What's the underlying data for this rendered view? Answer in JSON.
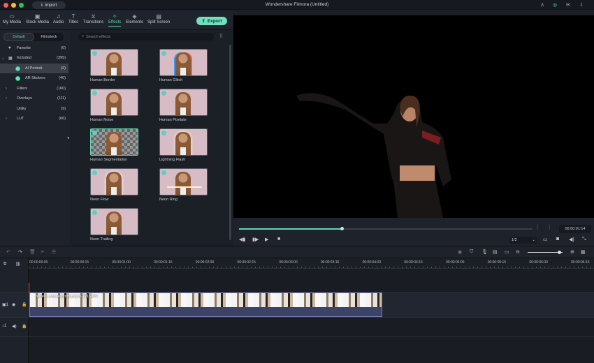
{
  "window": {
    "title": "Wondershare Filmora (Untitled)",
    "import_label": "Import"
  },
  "toolbar": {
    "tabs": [
      {
        "label": "My Media",
        "icon": "folder-icon"
      },
      {
        "label": "Stock Media",
        "icon": "image-icon"
      },
      {
        "label": "Audio",
        "icon": "music-icon"
      },
      {
        "label": "Titles",
        "icon": "text-icon"
      },
      {
        "label": "Transitions",
        "icon": "transition-icon"
      },
      {
        "label": "Effects",
        "icon": "effects-icon"
      },
      {
        "label": "Elements",
        "icon": "elements-icon"
      },
      {
        "label": "Split Screen",
        "icon": "split-screen-icon"
      }
    ],
    "active": "Effects",
    "export_label": "Export"
  },
  "left_panel": {
    "segments": [
      "Default",
      "Filmstock"
    ],
    "categories": [
      {
        "label": "Favorite",
        "count": "(0)"
      },
      {
        "label": "Included",
        "count": "(395)"
      },
      {
        "label": "AI Portrait",
        "count": "(9)"
      },
      {
        "label": "AR Stickers",
        "count": "(40)"
      },
      {
        "label": "Filters",
        "count": "(160)"
      },
      {
        "label": "Overlays",
        "count": "(111)"
      },
      {
        "label": "Utility",
        "count": "(9)"
      },
      {
        "label": "LUT",
        "count": "(66)"
      }
    ]
  },
  "effects": {
    "search_placeholder": "Search effects",
    "items": [
      "Human Border",
      "Human Glitch",
      "Human Noise",
      "Human Pixelate",
      "Human Segmentation",
      "Lightning Flash",
      "Neon Flow",
      "Neon Ring",
      "Neon Trailing"
    ],
    "selected": "Human Segmentation"
  },
  "player": {
    "timecode": "00:00:01:14",
    "progress_fraction": 0.35,
    "quality": "1/2"
  },
  "timeline": {
    "ruler": [
      "00:00:00:00",
      "00:00:00:15",
      "00:00:01:00",
      "00:00:01:15",
      "00:00:02:00",
      "00:00:02:15",
      "00:00:03:00",
      "00:00:03:15",
      "00:00:04:00",
      "00:00:04:15",
      "00:00:05:00",
      "00:00:05:15",
      "00:00:06:00",
      "00:00:06:15"
    ],
    "clip_name": "pexels-rodnae-productions-7216079",
    "video_track": "1",
    "audio_track": "1"
  },
  "colors": {
    "accent": "#5fd6b4",
    "export": "#6fe0c0"
  }
}
